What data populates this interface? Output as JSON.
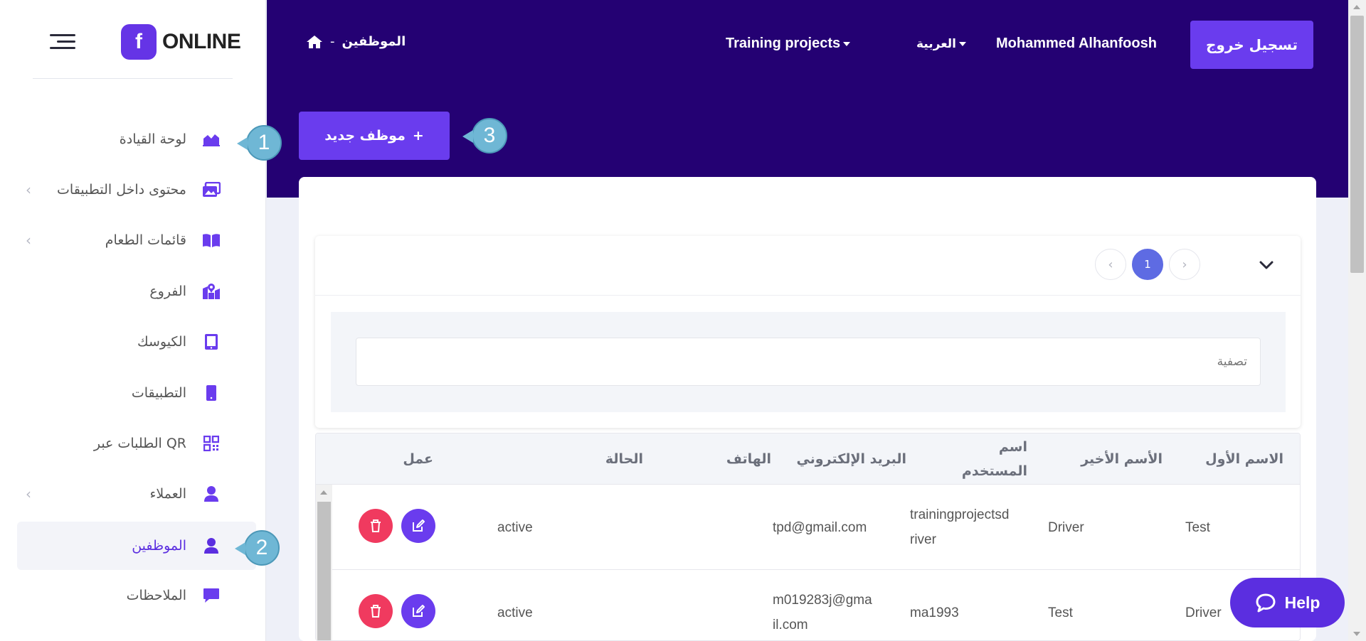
{
  "brand": {
    "logo_letter": "f",
    "logo_text": "ONLINE",
    "accent": "#6a3cee",
    "header_bg": "#240173"
  },
  "sidebar": {
    "items": [
      {
        "label": "لوحة القيادة",
        "icon": "chart-area-icon",
        "has_chevron": false,
        "active": false
      },
      {
        "label": "محتوى داخل التطبيقات",
        "icon": "images-icon",
        "has_chevron": true,
        "active": false
      },
      {
        "label": "قائمات الطعام",
        "icon": "book-open-icon",
        "has_chevron": true,
        "active": false
      },
      {
        "label": "الفروع",
        "icon": "map-marked-icon",
        "has_chevron": false,
        "active": false
      },
      {
        "label": "الكيوسك",
        "icon": "tablet-icon",
        "has_chevron": false,
        "active": false
      },
      {
        "label": "التطبيقات",
        "icon": "mobile-icon",
        "has_chevron": false,
        "active": false
      },
      {
        "label": "الطلبات عبر QR",
        "icon": "qrcode-icon",
        "has_chevron": false,
        "active": false
      },
      {
        "label": "العملاء",
        "icon": "user-icon",
        "has_chevron": true,
        "active": false
      },
      {
        "label": "الموظفين",
        "icon": "user-icon",
        "has_chevron": false,
        "active": true
      },
      {
        "label": "الملاحظات",
        "icon": "comment-icon",
        "has_chevron": false,
        "active": false
      }
    ]
  },
  "header": {
    "breadcrumb_current": "الموظفين",
    "breadcrumb_separator": "-",
    "training_projects": "Training projects",
    "language": "العربية",
    "user_name": "Mohammed Alhanfoosh",
    "logout_label": "تسجيل خروج"
  },
  "actions": {
    "new_employee_label": "موظف جديد",
    "new_employee_plus": "+"
  },
  "callouts": {
    "c1": "1",
    "c2": "2",
    "c3": "3"
  },
  "pagination": {
    "prev": "‹",
    "current": "1",
    "next": "›"
  },
  "filter": {
    "placeholder": "تصفية"
  },
  "table": {
    "headers": {
      "first_name": "الاسم الأول",
      "last_name": "الأسم الأخير",
      "username": "اسم المستخدم",
      "email": "البريد الإلكتروني",
      "phone": "الهاتف",
      "status": "الحالة",
      "action": "عمل"
    },
    "rows": [
      {
        "first_name": "Test",
        "last_name": "Driver",
        "username": "trainingprojectsdriver",
        "email": "tpd@gmail.com",
        "phone": "",
        "status": "active"
      },
      {
        "first_name": "Driver",
        "last_name": "Test",
        "username": "ma1993",
        "email": "m019283j@gmail.com",
        "phone": "",
        "status": "active"
      }
    ]
  },
  "help": {
    "label": "Help"
  }
}
